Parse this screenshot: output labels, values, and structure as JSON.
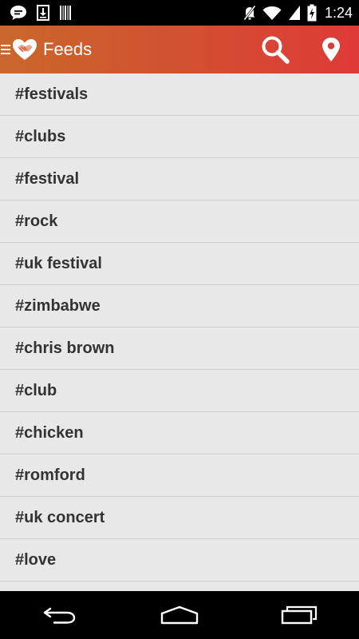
{
  "status_bar": {
    "time": "1:24",
    "icons": [
      "chat-notification-icon",
      "download-icon",
      "barcode-icon",
      "mute-icon",
      "wifi-icon",
      "signal-icon",
      "battery-charging-icon"
    ]
  },
  "app_bar": {
    "title": "Feeds",
    "icons": [
      "menu-icon",
      "heart-handshake-logo",
      "search-icon",
      "location-pin-icon"
    ],
    "accent_colors": [
      "#c9682b",
      "#df3a38"
    ]
  },
  "feeds": [
    {
      "label": "#festivals"
    },
    {
      "label": "#clubs"
    },
    {
      "label": "#festival"
    },
    {
      "label": "#rock"
    },
    {
      "label": "#uk festival"
    },
    {
      "label": "#zimbabwe"
    },
    {
      "label": "#chris brown"
    },
    {
      "label": "#club"
    },
    {
      "label": "#chicken"
    },
    {
      "label": "#romford"
    },
    {
      "label": "#uk concert"
    },
    {
      "label": "#love"
    }
  ],
  "nav_bar": {
    "icons": [
      "back-icon",
      "home-icon",
      "recent-apps-icon"
    ]
  }
}
